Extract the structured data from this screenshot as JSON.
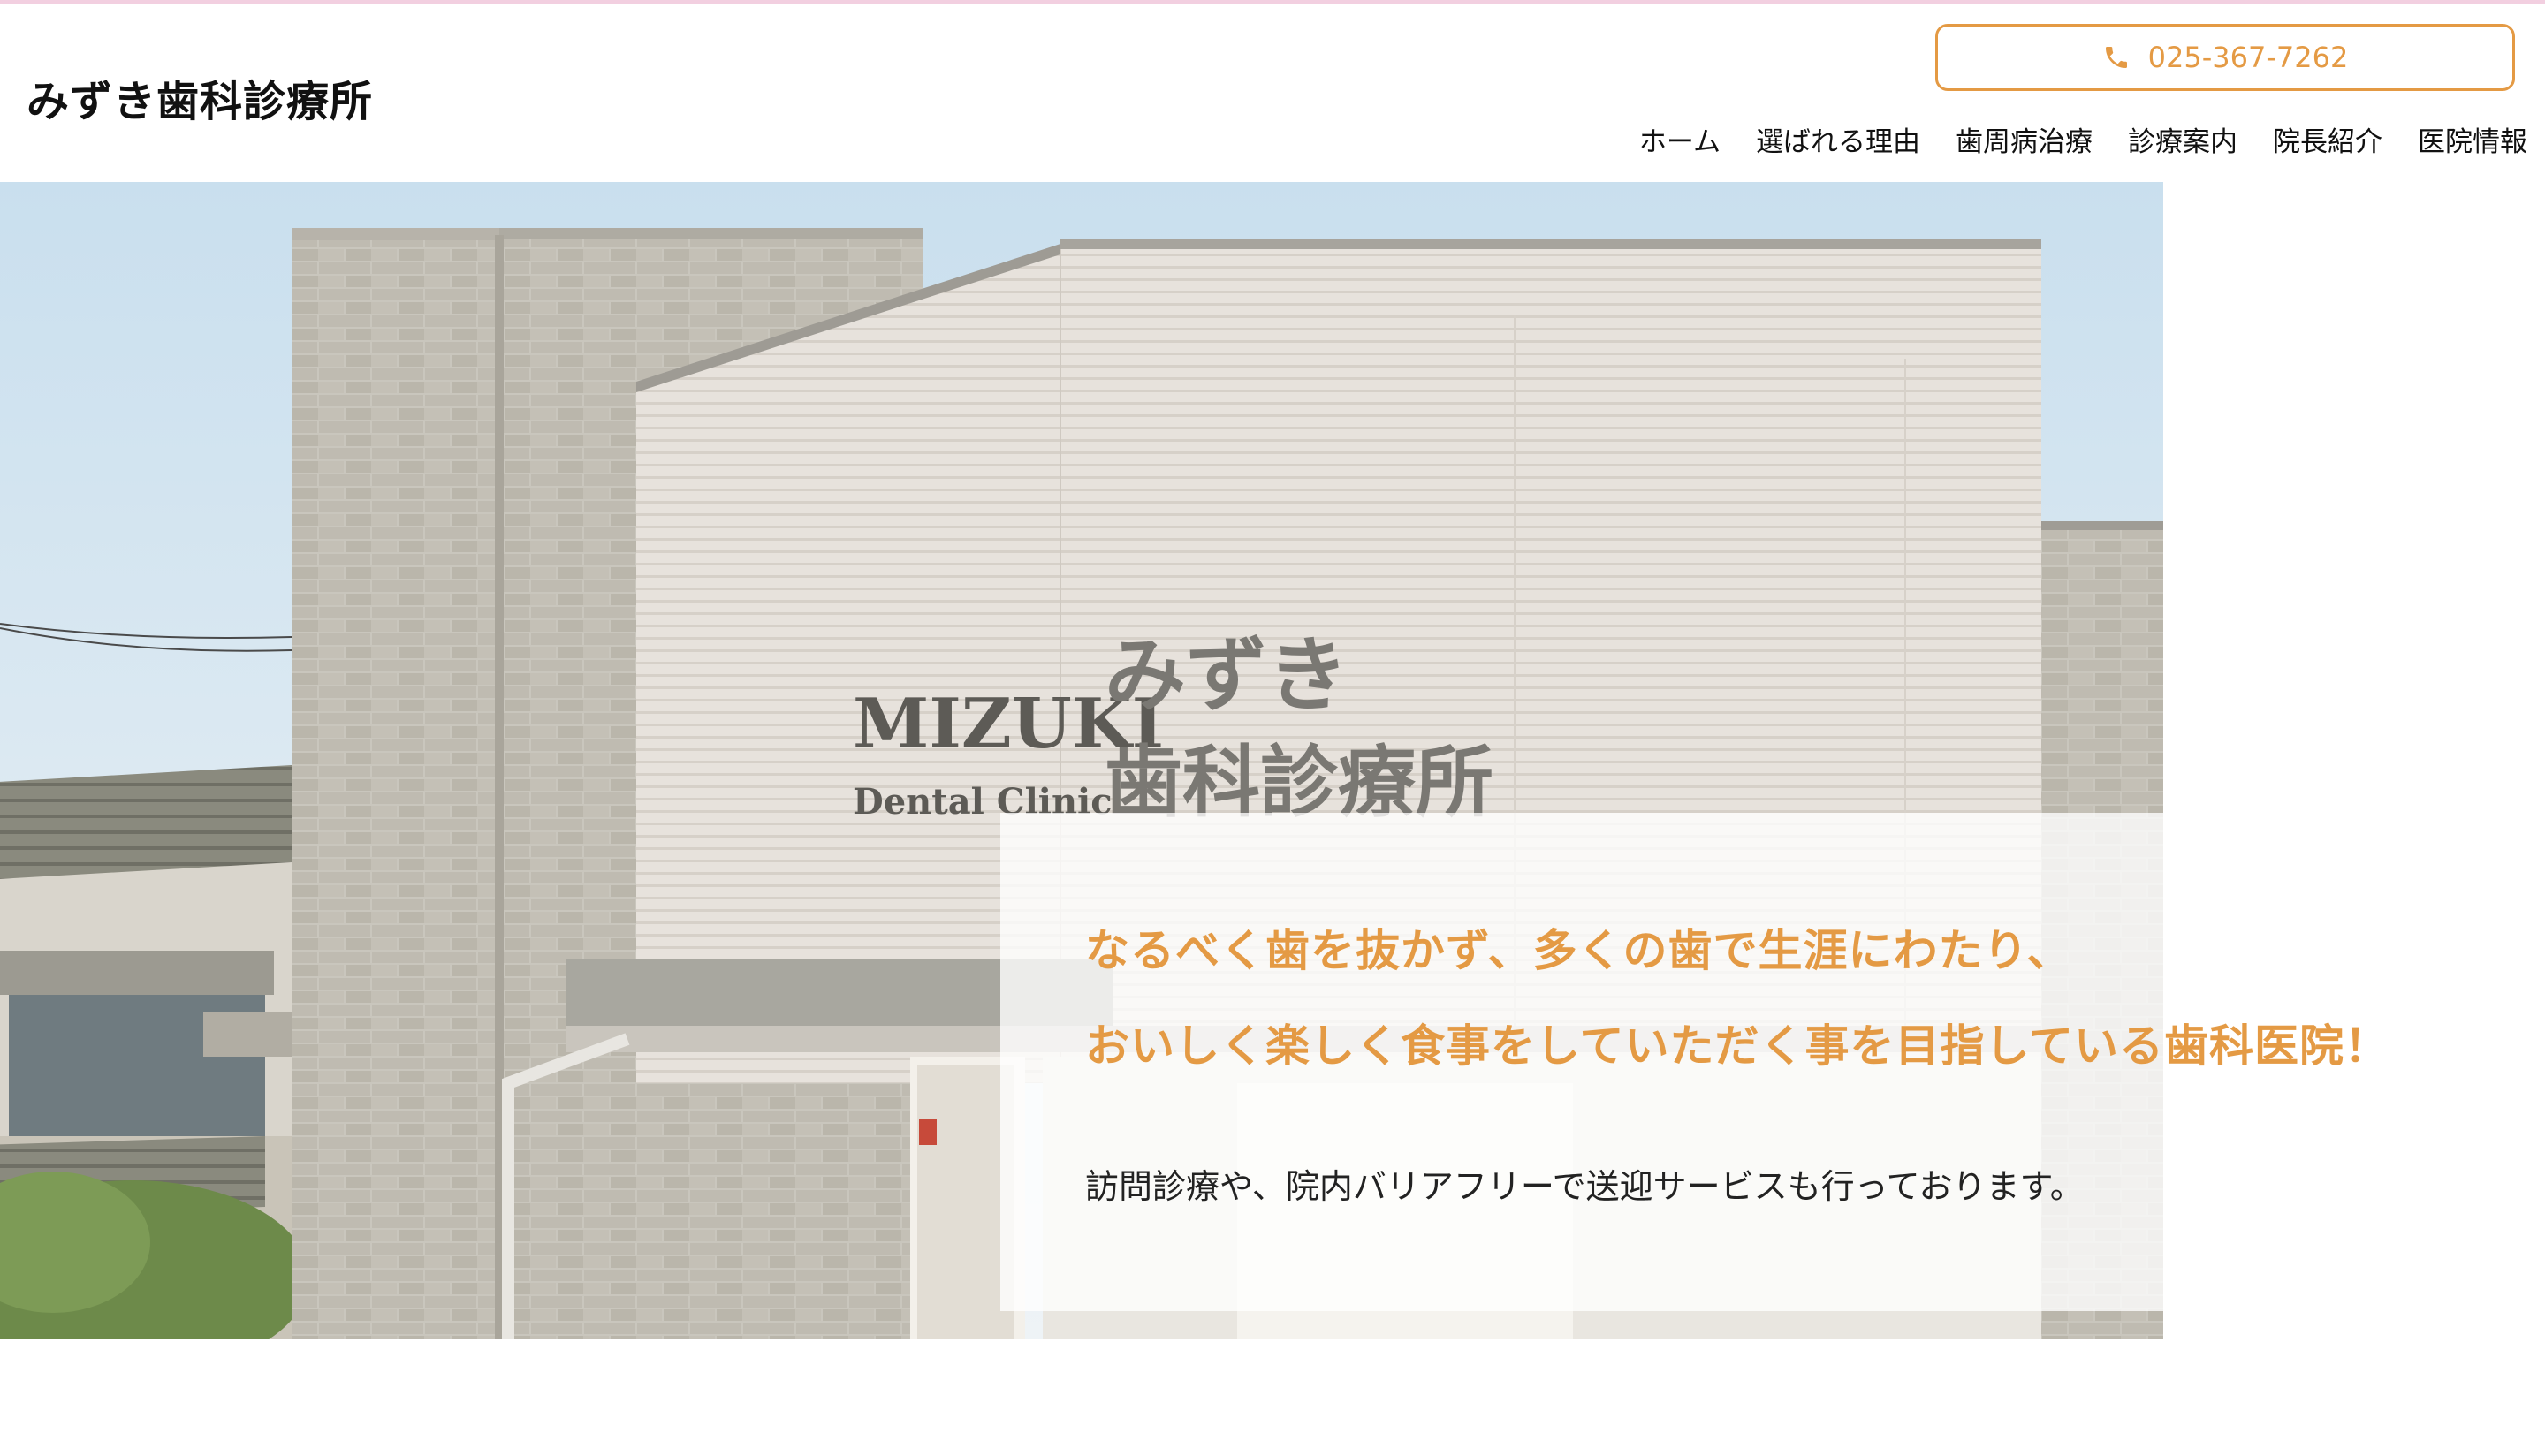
{
  "site": {
    "title": "みずき歯科診療所"
  },
  "header": {
    "phone": "025-367-7262",
    "phone_icon": "phone-icon"
  },
  "nav": {
    "items": [
      {
        "label": "ホーム"
      },
      {
        "label": "選ばれる理由"
      },
      {
        "label": "歯周病治療"
      },
      {
        "label": "診療案内"
      },
      {
        "label": "院長紹介"
      },
      {
        "label": "医院情報"
      }
    ]
  },
  "hero": {
    "sign_en_line1": "MIZUKI",
    "sign_en_line2": "Dental Clinic",
    "sign_jp_line1": "みずき",
    "sign_jp_line2": "歯科診療所",
    "tagline_line1": "なるべく歯を抜かず、多くの歯で生涯にわたり、",
    "tagline_line2": "おいしく楽しく食事をしていただく事を目指している歯科医院！",
    "subtext": "訪問診療や、院内バリアフリーで送迎サービスも行っております。"
  },
  "colors": {
    "accent": "#e49a44",
    "top_stripe": "#f2cfe0"
  }
}
